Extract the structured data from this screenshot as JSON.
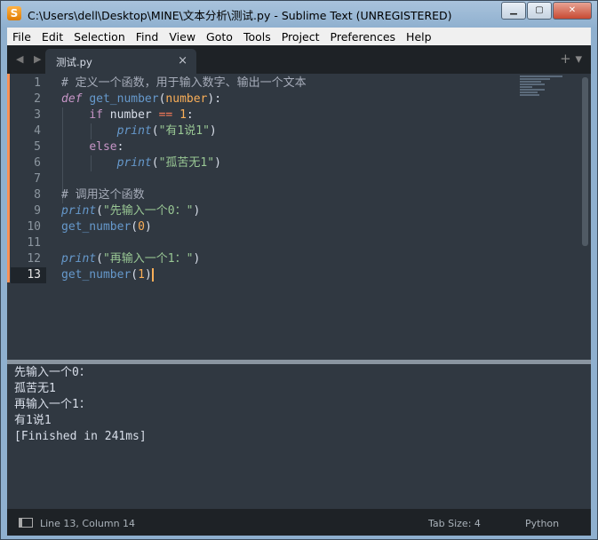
{
  "window": {
    "title": "C:\\Users\\dell\\Desktop\\MINE\\文本分析\\测试.py - Sublime Text (UNREGISTERED)",
    "buttons": {
      "minimize": "▁",
      "maximize": "▢",
      "close": "✕"
    }
  },
  "menu": [
    "File",
    "Edit",
    "Selection",
    "Find",
    "View",
    "Goto",
    "Tools",
    "Project",
    "Preferences",
    "Help"
  ],
  "tabs": {
    "nav": "◀ ▶",
    "active_label": "测试.py",
    "close": "×",
    "right_controls": "+ ▾"
  },
  "editor": {
    "current_line": 13,
    "lines": [
      {
        "n": "1",
        "tokens": [
          {
            "t": "# 定义一个函数，用于输入数字、输出一个文本",
            "c": "c-comment"
          }
        ]
      },
      {
        "n": "2",
        "tokens": [
          {
            "t": "def",
            "c": "c-kw"
          },
          {
            "t": " ",
            "c": "c-punc"
          },
          {
            "t": "get_number",
            "c": "c-fn"
          },
          {
            "t": "(",
            "c": "c-punc"
          },
          {
            "t": "number",
            "c": "c-param"
          },
          {
            "t": "):",
            "c": "c-punc"
          }
        ]
      },
      {
        "n": "3",
        "tokens": [
          {
            "t": "    ",
            "c": "c-punc"
          },
          {
            "t": "if",
            "c": "c-kw2"
          },
          {
            "t": " number ",
            "c": "c-punc"
          },
          {
            "t": "==",
            "c": "c-op"
          },
          {
            "t": " ",
            "c": "c-punc"
          },
          {
            "t": "1",
            "c": "c-num"
          },
          {
            "t": ":",
            "c": "c-punc"
          }
        ]
      },
      {
        "n": "4",
        "tokens": [
          {
            "t": "        ",
            "c": "c-punc"
          },
          {
            "t": "print",
            "c": "c-builtin"
          },
          {
            "t": "(",
            "c": "c-punc"
          },
          {
            "t": "\"有1说1\"",
            "c": "c-str"
          },
          {
            "t": ")",
            "c": "c-punc"
          }
        ]
      },
      {
        "n": "5",
        "tokens": [
          {
            "t": "    ",
            "c": "c-punc"
          },
          {
            "t": "else",
            "c": "c-kw2"
          },
          {
            "t": ":",
            "c": "c-punc"
          }
        ]
      },
      {
        "n": "6",
        "tokens": [
          {
            "t": "        ",
            "c": "c-punc"
          },
          {
            "t": "print",
            "c": "c-builtin"
          },
          {
            "t": "(",
            "c": "c-punc"
          },
          {
            "t": "\"孤苦无1\"",
            "c": "c-str"
          },
          {
            "t": ")",
            "c": "c-punc"
          }
        ]
      },
      {
        "n": "7",
        "tokens": []
      },
      {
        "n": "8",
        "tokens": [
          {
            "t": "# 调用这个函数",
            "c": "c-comment"
          }
        ]
      },
      {
        "n": "9",
        "tokens": [
          {
            "t": "print",
            "c": "c-builtin"
          },
          {
            "t": "(",
            "c": "c-punc"
          },
          {
            "t": "\"先输入一个0：\"",
            "c": "c-str"
          },
          {
            "t": ")",
            "c": "c-punc"
          }
        ]
      },
      {
        "n": "10",
        "tokens": [
          {
            "t": "get_number",
            "c": "c-fn"
          },
          {
            "t": "(",
            "c": "c-punc"
          },
          {
            "t": "0",
            "c": "c-num"
          },
          {
            "t": ")",
            "c": "c-punc"
          }
        ]
      },
      {
        "n": "11",
        "tokens": []
      },
      {
        "n": "12",
        "tokens": [
          {
            "t": "print",
            "c": "c-builtin"
          },
          {
            "t": "(",
            "c": "c-punc"
          },
          {
            "t": "\"再输入一个1：\"",
            "c": "c-str"
          },
          {
            "t": ")",
            "c": "c-punc"
          }
        ]
      },
      {
        "n": "13",
        "tokens": [
          {
            "t": "get_number",
            "c": "c-fn"
          },
          {
            "t": "(",
            "c": "c-punc"
          },
          {
            "t": "1",
            "c": "c-num"
          },
          {
            "t": ")",
            "c": "c-punc"
          }
        ]
      }
    ]
  },
  "output": {
    "lines": [
      "先输入一个0：",
      "孤苦无1",
      "再输入一个1：",
      "有1说1",
      "[Finished in 241ms]"
    ]
  },
  "status": {
    "position": "Line 13, Column 14",
    "tab_size": "Tab Size: 4",
    "syntax": "Python"
  },
  "colors": {
    "editor_bg": "#303841",
    "chrome_bg": "#1e2226",
    "comment": "#a6acb9",
    "keyword": "#c695c6",
    "function": "#6699cc",
    "string": "#99c794",
    "number": "#f9ae58",
    "operator": "#f97b58"
  }
}
